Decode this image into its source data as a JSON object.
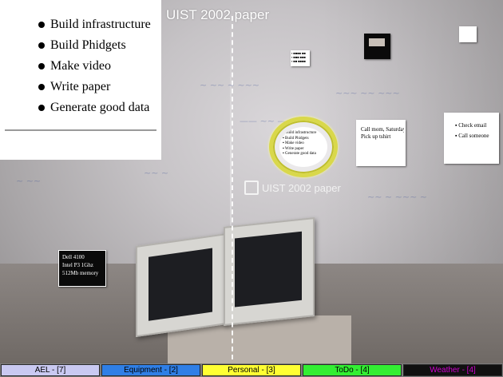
{
  "todo_list": {
    "items": [
      "Build infrastructure",
      "Build Phidgets",
      "Make video",
      "Write paper",
      "Generate good data"
    ]
  },
  "overlay": {
    "title": "UIST 2002 paper",
    "cursor_label": "UIST 2002 paper"
  },
  "notes": {
    "top_small": [
      "▪ ■■■■ ■■",
      "▪ ■■■ ■■■",
      "▪ ■■ ■■■■"
    ],
    "focus_ring": [
      "▪ Build infrastructure",
      "▪ Build Phidgets",
      "▪ Make video",
      "▪ Write paper",
      "▪ Generate good data"
    ],
    "middle_right": [
      "Call mom, Saturday",
      "Pick up tshirt"
    ],
    "far_right": [
      "▪ Check email",
      "▪ Call someone"
    ],
    "dark_left": [
      "Dell 4100",
      "Intel P3 1Ghz",
      "512Mb memory"
    ]
  },
  "taskbar": {
    "tabs": [
      {
        "label": "AEL - [7]",
        "bg": "#c9c9f2",
        "color": "#000000"
      },
      {
        "label": "Equipment - [2]",
        "bg": "#2f7fe6",
        "color": "#000000"
      },
      {
        "label": "Personal - [3]",
        "bg": "#ffff33",
        "color": "#000000"
      },
      {
        "label": "ToDo - [4]",
        "bg": "#33ee33",
        "color": "#000000"
      },
      {
        "label": "Weather - [4]",
        "bg": "#101010",
        "color": "#d000d0"
      }
    ]
  },
  "colors": {
    "focus_ring": "#d9d84a",
    "dashed_guide": "#ffffff"
  }
}
